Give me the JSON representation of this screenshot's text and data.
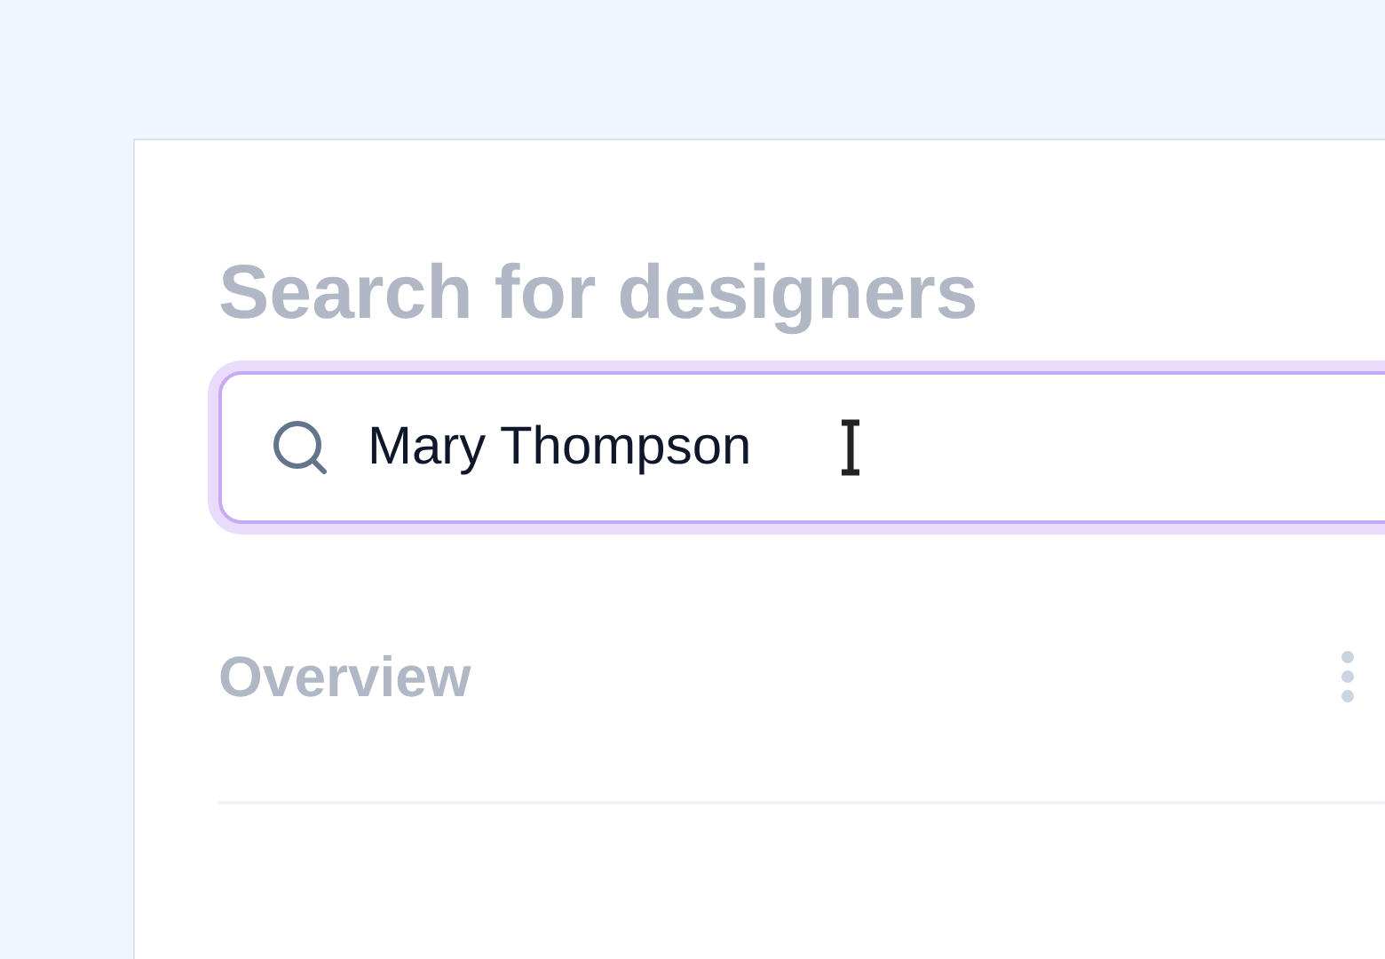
{
  "title": "Search for designers",
  "search": {
    "value": "Mary Thompson"
  },
  "section": {
    "title": "Overview"
  }
}
